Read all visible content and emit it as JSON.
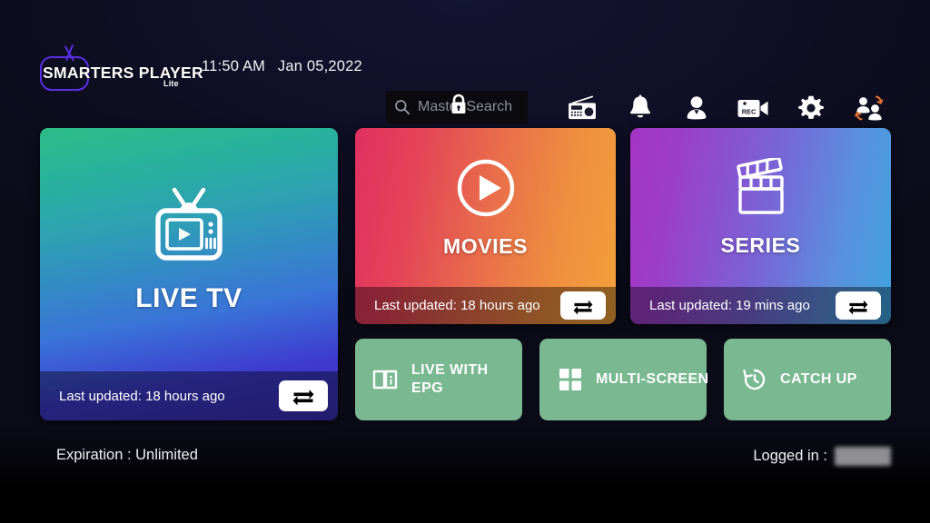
{
  "app": {
    "name": "SMARTERS PLAYER",
    "name_suffix": "Lite",
    "logo_icon": "tv-outline-icon"
  },
  "header": {
    "time": "11:50 AM",
    "date": "Jan 05,2022",
    "search": {
      "placeholder": "Master Search",
      "value": "",
      "search_icon": "search-icon",
      "lock_icon": "lock-icon"
    },
    "icons": [
      {
        "name": "radio-icon",
        "label": "Radio"
      },
      {
        "name": "bell-icon",
        "label": "Notifications"
      },
      {
        "name": "person-icon",
        "label": "Account"
      },
      {
        "name": "rec-camera-icon",
        "label": "Recordings"
      },
      {
        "name": "gear-icon",
        "label": "Settings"
      },
      {
        "name": "switch-user-icon",
        "label": "Switch User"
      }
    ]
  },
  "cards": [
    {
      "id": "livetv",
      "title": "LIVE TV",
      "icon": "retro-tv-play-icon",
      "last_updated": "Last updated: 18 hours ago",
      "refresh_icon": "refresh-repeat-icon",
      "gradient_from": "#2bbd86",
      "gradient_to": "#3b30b8"
    },
    {
      "id": "movies",
      "title": "MOVIES",
      "icon": "play-circle-icon",
      "last_updated": "Last updated: 18 hours ago",
      "refresh_icon": "refresh-repeat-icon",
      "gradient_from": "#e03060",
      "gradient_to": "#f2a03a"
    },
    {
      "id": "series",
      "title": "SERIES",
      "icon": "clapperboard-icon",
      "last_updated": "Last updated: 19 mins ago",
      "refresh_icon": "refresh-repeat-icon",
      "gradient_from": "#a534c4",
      "gradient_to": "#3fa3df"
    }
  ],
  "tiles": [
    {
      "id": "epg",
      "label": "LIVE WITH\nEPG",
      "icon": "book-info-icon"
    },
    {
      "id": "multi",
      "label": "MULTI-SCREEN",
      "icon": "grid-four-icon"
    },
    {
      "id": "catch",
      "label": "CATCH UP",
      "icon": "clock-rewind-icon"
    }
  ],
  "footer": {
    "expiration": "Expiration : Unlimited",
    "logged_in_label": "Logged in :",
    "logged_in_value": ""
  },
  "colors": {
    "background": "#0b0b18",
    "tile_green": "#79b890",
    "logo_purple": "#5b2ee8",
    "text_primary": "#ffffff",
    "search_placeholder": "#8e8e99"
  }
}
